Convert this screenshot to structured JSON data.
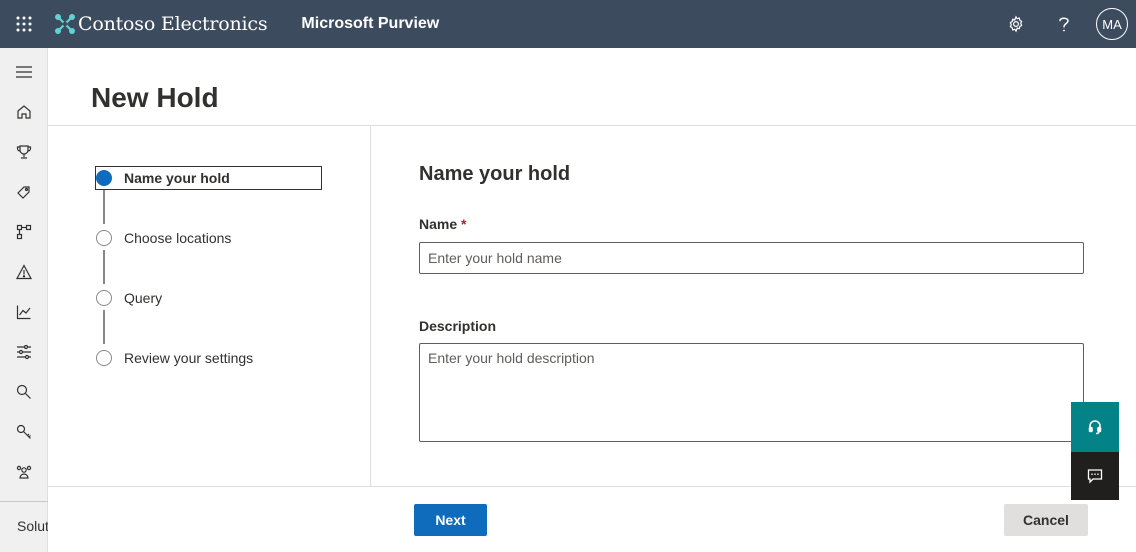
{
  "topbar": {
    "brand_name": "Contoso Electronics",
    "app_name": "Microsoft Purview",
    "avatar_initials": "MA"
  },
  "nav": {
    "items": [
      "menu-icon",
      "home-icon",
      "trophy-icon",
      "tag-icon",
      "flow-icon",
      "warning-icon",
      "chart-icon",
      "settings-sliders-icon",
      "search-icon",
      "key-icon",
      "people-icon"
    ],
    "solutions_label": "Solutions"
  },
  "page": {
    "title": "New Hold"
  },
  "steps": [
    {
      "label": "Name your hold",
      "active": true
    },
    {
      "label": "Choose locations",
      "active": false
    },
    {
      "label": "Query",
      "active": false
    },
    {
      "label": "Review your settings",
      "active": false
    }
  ],
  "form": {
    "title": "Name your hold",
    "name_label": "Name",
    "required_mark": "*",
    "name_placeholder": "Enter your hold name",
    "name_value": "",
    "description_label": "Description",
    "description_placeholder": "Enter your hold description",
    "description_value": ""
  },
  "footer": {
    "next_label": "Next",
    "cancel_label": "Cancel"
  },
  "colors": {
    "topbar": "#3c4b5e",
    "primary": "#0f6cbd",
    "help_button": "#038387",
    "feedback_button": "#201f1e"
  }
}
